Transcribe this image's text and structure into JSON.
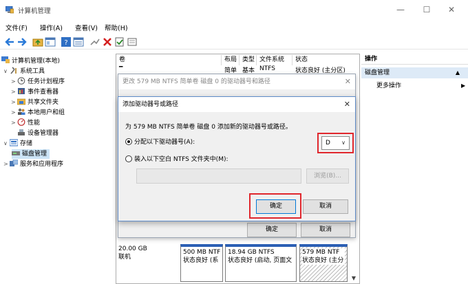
{
  "window": {
    "title": "计算机管理",
    "controls": [
      "—",
      "☐",
      "✕"
    ]
  },
  "menu": [
    "文件(F)",
    "操作(A)",
    "查看(V)",
    "帮助(H)"
  ],
  "tree": [
    {
      "label": "计算机管理(本地)",
      "level": 0,
      "caret": ""
    },
    {
      "label": "系统工具",
      "level": 1,
      "caret": "∨"
    },
    {
      "label": "任务计划程序",
      "level": 2,
      "caret": ">"
    },
    {
      "label": "事件查看器",
      "level": 2,
      "caret": ">"
    },
    {
      "label": "共享文件夹",
      "level": 2,
      "caret": ">"
    },
    {
      "label": "本地用户和组",
      "level": 2,
      "caret": ">"
    },
    {
      "label": "性能",
      "level": 2,
      "caret": ">"
    },
    {
      "label": "设备管理器",
      "level": 2,
      "caret": ""
    },
    {
      "label": "存储",
      "level": 1,
      "caret": "∨"
    },
    {
      "label": "磁盘管理",
      "level": 2,
      "caret": ""
    },
    {
      "label": "服务和应用程序",
      "level": 1,
      "caret": ">"
    }
  ],
  "columns": [
    "卷",
    "布局",
    "类型",
    "文件系统",
    "状态"
  ],
  "volume_row": [
    "━",
    "简单",
    "基本",
    "NTFS",
    "状态良好 (主分区)"
  ],
  "disk": {
    "size": "20.00 GB",
    "status": "联机"
  },
  "partitions": [
    {
      "line1": "500 MB NTF",
      "line2": "状态良好 (系"
    },
    {
      "line1": "18.94 GB NTFS",
      "line2": "状态良好 (启动, 页面文"
    },
    {
      "line1": "579 MB NTF",
      "line2": "状态良好 (主分"
    }
  ],
  "ops": {
    "header": "操作",
    "section": "磁盘管理",
    "more": "更多操作"
  },
  "dialog_change": {
    "title": "更改 579 MB NTFS 简单卷 磁盘 0 的驱动器号和路径",
    "ok": "确定",
    "cancel": "取消"
  },
  "dialog_add": {
    "title": "添加驱动器号或路径",
    "description": "为 579 MB NTFS 简单卷 磁盘 0 添加新的驱动器号或路径。",
    "option_assign": "分配以下驱动器号(A):",
    "option_mount": "装入以下空白 NTFS 文件夹中(M):",
    "drive_letter": "D",
    "browse": "浏览(B)...",
    "ok": "确定",
    "cancel": "取消"
  },
  "colors": {
    "highlight": "#e0272d",
    "accent": "#0078d7",
    "selected_bg": "#ddeaf7"
  }
}
